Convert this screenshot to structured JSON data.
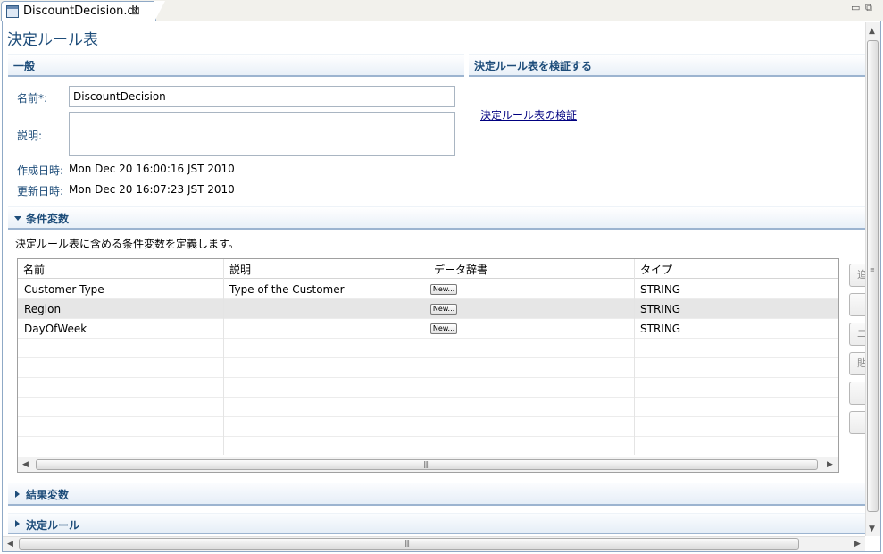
{
  "tab": {
    "title": "DiscountDecision.dt",
    "close_glyph": "⊠"
  },
  "window_controls": {
    "minimize": "▭",
    "maximize": "⧉"
  },
  "page_title": "決定ルール表",
  "general": {
    "header": "一般",
    "name_label": "名前*:",
    "name_value": "DiscountDecision",
    "desc_label": "説明:",
    "desc_value": "",
    "created_label": "作成日時:",
    "created_value": "Mon Dec 20 16:00:16 JST 2010",
    "updated_label": "更新日時:",
    "updated_value": "Mon Dec 20 16:07:23 JST 2010"
  },
  "validate": {
    "header": "決定ルール表を検証する",
    "link": "決定ルール表の検証"
  },
  "conditions": {
    "header": "条件変数",
    "description": "決定ルール表に含める条件変数を定義します。",
    "columns": [
      "名前",
      "説明",
      "データ辞書",
      "タイプ"
    ],
    "rows": [
      {
        "name": "Customer Type",
        "desc": "Type of  the Customer",
        "dict_button": "New...",
        "type": "STRING",
        "selected": false
      },
      {
        "name": "Region",
        "desc": "",
        "dict_button": "New...",
        "type": "STRING",
        "selected": true
      },
      {
        "name": "DayOfWeek",
        "desc": "",
        "dict_button": "New...",
        "type": "STRING",
        "selected": false
      }
    ],
    "side_buttons": [
      "追",
      "",
      "二",
      "貼",
      "",
      ""
    ]
  },
  "results": {
    "header": "結果変数"
  },
  "rules": {
    "header": "決定ルール"
  },
  "icons": {
    "editor": "dt-file-icon",
    "expanded": "triangle-down-icon",
    "collapsed": "triangle-right-icon"
  },
  "colors": {
    "accent": "#1e4d7a",
    "section_border": "#9cb4d0",
    "link": "#000080"
  }
}
